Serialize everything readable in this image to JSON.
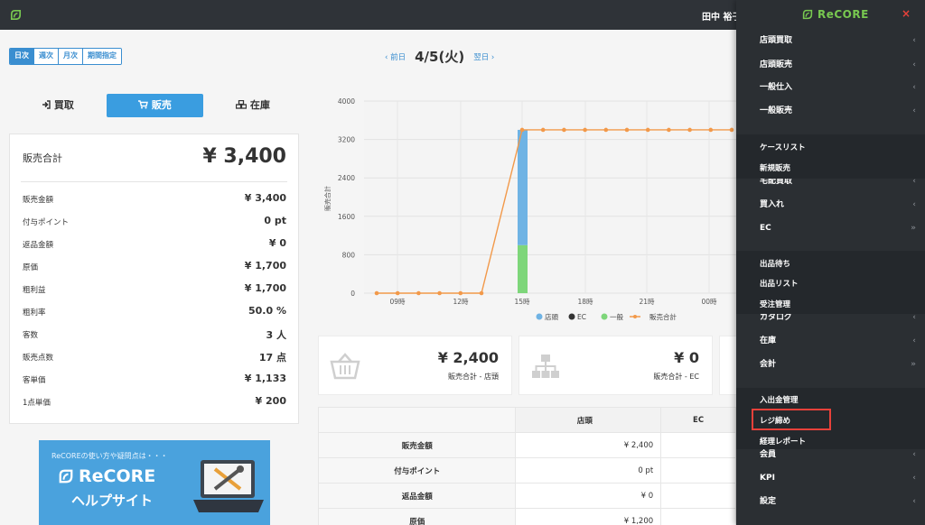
{
  "topbar": {
    "user_name": "田中 裕子"
  },
  "brand": {
    "name": "ReCORE",
    "close": "×"
  },
  "period_tabs": [
    "日次",
    "週次",
    "月次",
    "期間指定"
  ],
  "date_nav": {
    "prev": "‹ 前日",
    "date": "4/5(火)",
    "next": "翌日 ›"
  },
  "type_tabs": [
    "買取",
    "販売",
    "在庫"
  ],
  "summary": {
    "total_label": "販売合計",
    "total_value": "¥ 3,400",
    "rows": [
      {
        "label": "販売金額",
        "value": "¥ 3,400"
      },
      {
        "label": "付与ポイント",
        "value": "0 pt"
      },
      {
        "label": "返品金額",
        "value": "¥ 0"
      },
      {
        "label": "原価",
        "value": "¥ 1,700"
      },
      {
        "label": "粗利益",
        "value": "¥ 1,700"
      },
      {
        "label": "粗利率",
        "value": "50.0 %"
      },
      {
        "label": "客数",
        "value": "3 人"
      },
      {
        "label": "販売点数",
        "value": "17 点"
      },
      {
        "label": "客単価",
        "value": "¥ 1,133"
      },
      {
        "label": "1点単価",
        "value": "¥ 200"
      }
    ]
  },
  "banner": {
    "subtitle": "ReCOREの使い方や疑問点は・・・",
    "brand": "ReCORE",
    "help": "ヘルプサイト"
  },
  "chart_data": {
    "type": "bar",
    "ylabel": "販売合計",
    "ylim": [
      0,
      4000
    ],
    "yticks": [
      "0",
      "800",
      "1600",
      "2400",
      "3200",
      "4000"
    ],
    "xticks": [
      "09時",
      "12時",
      "15時",
      "18時",
      "21時",
      "00時"
    ],
    "bar_x": "15時",
    "bars": [
      {
        "name": "一般",
        "value": 1000,
        "color": "#7ed67a"
      },
      {
        "name": "店頭",
        "value": 2400,
        "color": "#6fb3e4"
      }
    ],
    "line": {
      "name": "販売合計",
      "color": "#f2994a",
      "before": 0,
      "after": 3400
    },
    "legend": [
      {
        "name": "店頭",
        "color": "#6fb3e4"
      },
      {
        "name": "EC",
        "color": "#333333"
      },
      {
        "name": "一般",
        "color": "#7ed67a"
      },
      {
        "name": "販売合計",
        "color": "#f2994a"
      }
    ]
  },
  "kpis": [
    {
      "value": "¥ 2,400",
      "label": "販売合計 - 店頭"
    },
    {
      "value": "¥ 0",
      "label": "販売合計 - EC"
    }
  ],
  "table": {
    "headers": [
      "",
      "店頭",
      "EC"
    ],
    "rows": [
      {
        "label": "販売金額",
        "v1": "¥ 2,400",
        "v2": ""
      },
      {
        "label": "付与ポイント",
        "v1": "0 pt",
        "v2": ""
      },
      {
        "label": "返品金額",
        "v1": "¥ 0",
        "v2": ""
      },
      {
        "label": "原価",
        "v1": "¥ 1,200",
        "v2": ""
      }
    ]
  },
  "sidebar": {
    "menus": [
      {
        "label": "店頭買取",
        "chev": "‹"
      },
      {
        "label": "店頭販売",
        "chev": "‹"
      },
      {
        "label": "一般仕入",
        "chev": "‹"
      },
      {
        "label": "一般販売",
        "chev": "‹"
      },
      {
        "label": "宅配買取",
        "chev": "‹"
      },
      {
        "label": "買入れ",
        "chev": "‹"
      },
      {
        "label": "EC",
        "chev": "»"
      },
      {
        "label": "カタログ",
        "chev": "‹"
      },
      {
        "label": "在庫",
        "chev": "‹"
      },
      {
        "label": "会計",
        "chev": "»"
      },
      {
        "label": "会員",
        "chev": "‹"
      },
      {
        "label": "KPI",
        "chev": "‹"
      },
      {
        "label": "設定",
        "chev": "‹"
      }
    ],
    "subs": [
      "ケースリスト",
      "新規販売",
      "出品待ち",
      "出品リスト",
      "受注管理",
      "入出金管理",
      "レジ締め",
      "経理レポート"
    ]
  }
}
